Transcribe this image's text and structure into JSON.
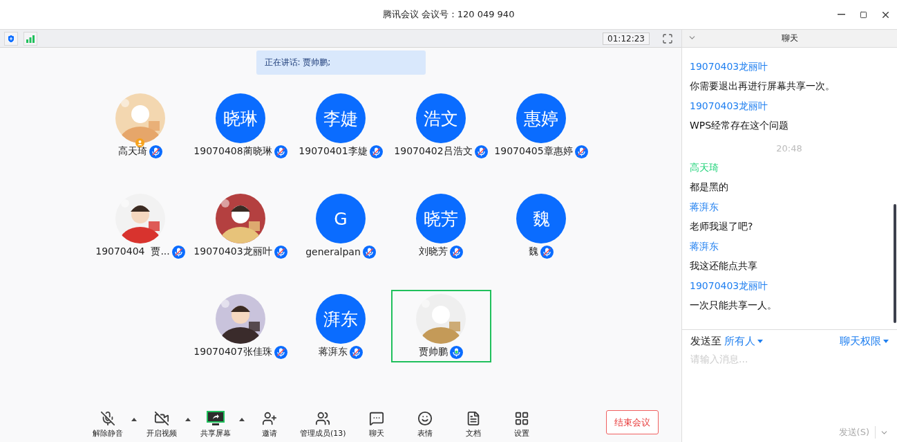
{
  "window": {
    "title": "腾讯会议 会议号：120 049 940"
  },
  "status_strip": {
    "timer": "01:12:23"
  },
  "speaking_banner": "正在讲话: 贾帅鹏;",
  "grid_rows": [
    [
      {
        "name": "高天琦",
        "host": true,
        "muted": true,
        "active_speaker": false
      },
      {
        "name": "19070408蔺晓琳",
        "avatar": {
          "kind": "initials",
          "text": "晓琳"
        },
        "host": false,
        "muted": true,
        "active_speaker": false
      },
      {
        "name": "19070401李婕",
        "avatar": {
          "kind": "initials",
          "text": "李婕"
        },
        "host": false,
        "muted": true,
        "active_speaker": false
      },
      {
        "name": "19070402吕浩文",
        "avatar": {
          "kind": "initials",
          "text": "浩文"
        },
        "host": false,
        "muted": true,
        "active_speaker": false
      },
      {
        "name": "19070405章惠婷",
        "avatar": {
          "kind": "initials",
          "text": "惠婷"
        },
        "host": false,
        "muted": true,
        "active_speaker": false
      }
    ],
    [
      {
        "name": "19070404  贾...",
        "host": false,
        "muted": true,
        "active_speaker": false
      },
      {
        "name": "19070403龙丽叶",
        "host": false,
        "muted": true,
        "active_speaker": false
      },
      {
        "name": "generalpan",
        "avatar": {
          "kind": "initials",
          "text": "G"
        },
        "host": false,
        "muted": true,
        "active_speaker": false
      },
      {
        "name": "刘晓芳",
        "avatar": {
          "kind": "initials",
          "text": "晓芳"
        },
        "host": false,
        "muted": true,
        "active_speaker": false
      },
      {
        "name": "魏",
        "avatar": {
          "kind": "initials",
          "text": "魏"
        },
        "host": false,
        "muted": true,
        "active_speaker": false
      }
    ],
    [
      {
        "name": "19070407张佳珠",
        "host": false,
        "muted": true,
        "active_speaker": false
      },
      {
        "name": "蒋湃东",
        "avatar": {
          "kind": "initials",
          "text": "湃东"
        },
        "host": false,
        "muted": true,
        "active_speaker": false
      },
      {
        "name": "贾帅鹏",
        "host": false,
        "muted": false,
        "active_speaker": true
      }
    ]
  ],
  "toolbar": [
    {
      "kind": "mute",
      "label": "解除静音",
      "has_menu": true
    },
    {
      "kind": "video",
      "label": "开启视频",
      "has_menu": true
    },
    {
      "kind": "share",
      "label": "共享屏幕",
      "has_menu": true
    },
    {
      "kind": "invite",
      "label": "邀请",
      "has_menu": false
    },
    {
      "kind": "members",
      "label": "管理成员(13)",
      "has_menu": false
    },
    {
      "kind": "chat",
      "label": "聊天",
      "has_menu": false
    },
    {
      "kind": "emoji",
      "label": "表情",
      "has_menu": false
    },
    {
      "kind": "docs",
      "label": "文档",
      "has_menu": false
    },
    {
      "kind": "settings",
      "label": "设置",
      "has_menu": false
    }
  ],
  "end_button": "结束会议",
  "chat": {
    "title": "聊天",
    "items": [
      {
        "kind": "message",
        "sender": "19070403龙丽叶",
        "color": "#1f7ff0",
        "text": "你需要退出再进行屏幕共享一次。"
      },
      {
        "kind": "message",
        "sender": "19070403龙丽叶",
        "color": "#1f7ff0",
        "text": "WPS经常存在这个问题"
      },
      {
        "kind": "time",
        "text": "20:48"
      },
      {
        "kind": "message",
        "sender": "高天琦",
        "color": "#22d37a",
        "text": "都是黑的"
      },
      {
        "kind": "message",
        "sender": "蒋湃东",
        "color": "#1f7ff0",
        "text": "老师我退了吧?"
      },
      {
        "kind": "message",
        "sender": "蒋湃东",
        "color": "#1f7ff0",
        "text": "我这还能点共享"
      },
      {
        "kind": "message",
        "sender": "19070403龙丽叶",
        "color": "#1f7ff0",
        "text": "一次只能共享一人。"
      }
    ],
    "composer": {
      "send_to_label": "发送至",
      "recipient": "所有人",
      "permissions": "聊天权限",
      "placeholder": "请输入消息...",
      "send_button": {
        "label": "发送(S)",
        "disabled": true
      }
    }
  }
}
